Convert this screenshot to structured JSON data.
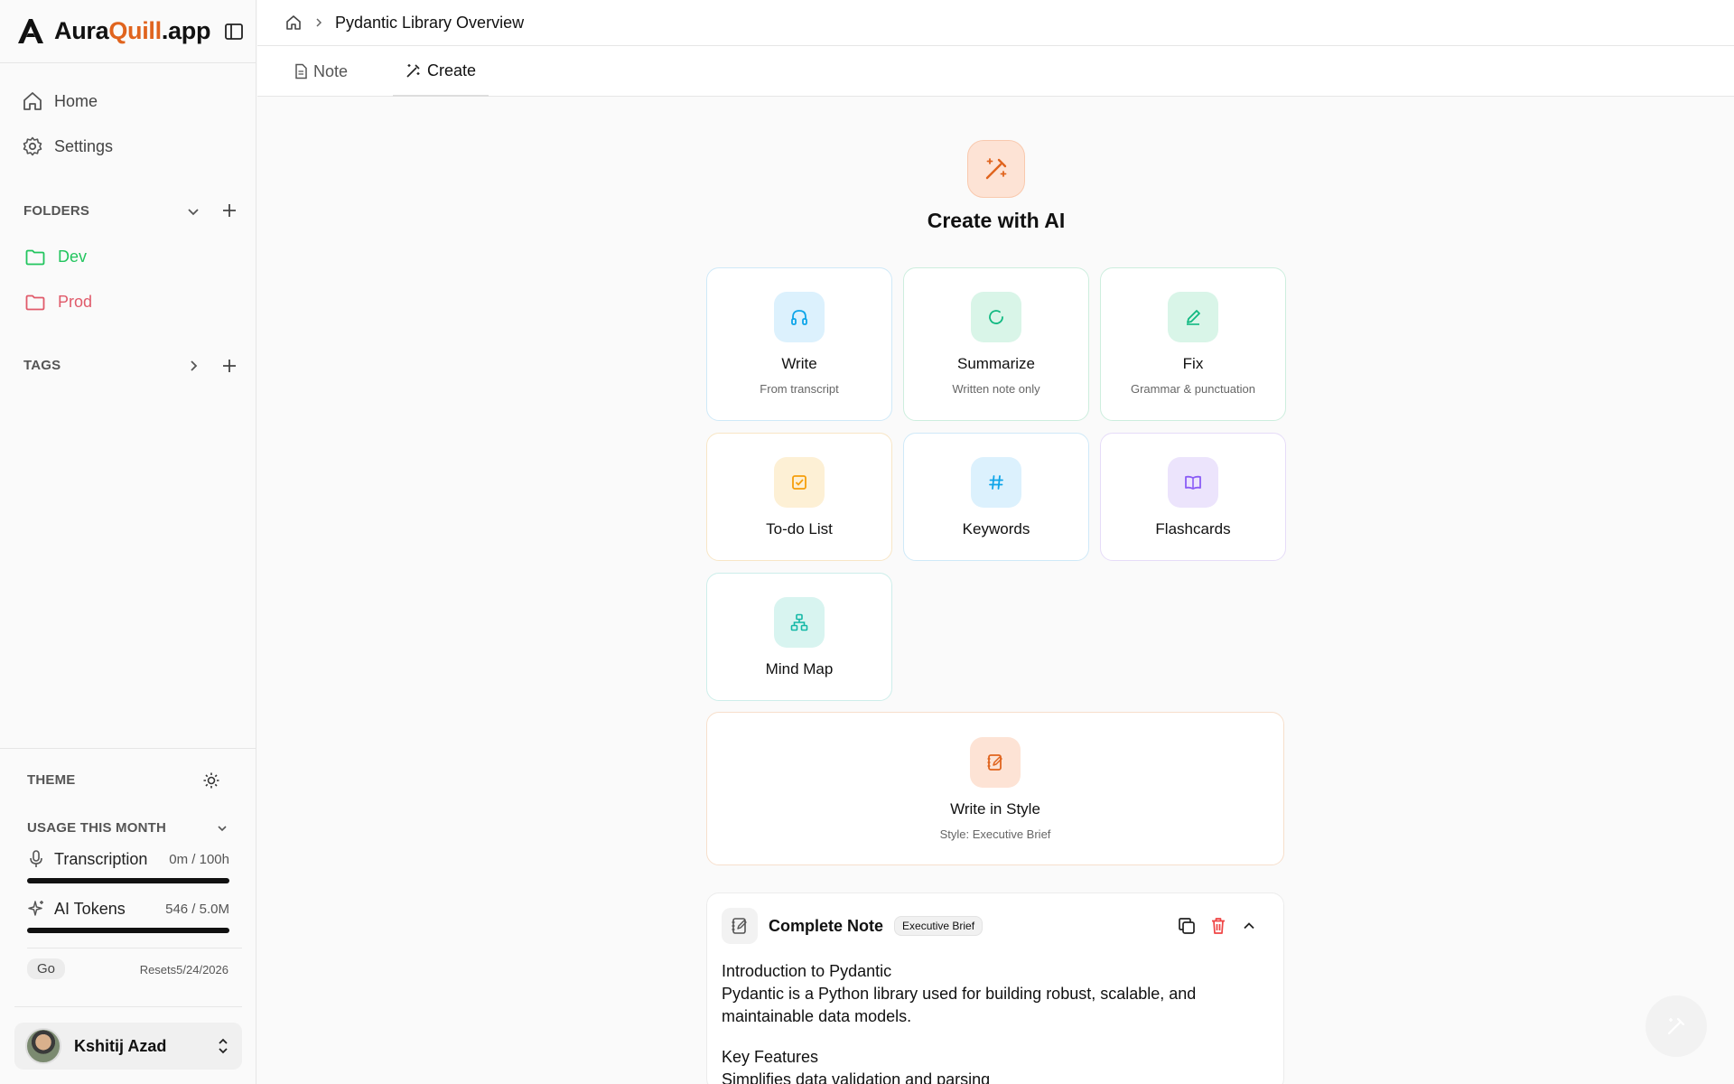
{
  "brand": {
    "name_part1": "Aura",
    "name_part2": "Quill",
    "name_part3": ".app",
    "accent": "#e0641e"
  },
  "sidebar": {
    "nav": [
      {
        "label": "Home",
        "icon": "home-icon"
      },
      {
        "label": "Settings",
        "icon": "gear-icon"
      }
    ],
    "folders_heading": "FOLDERS",
    "folders": [
      {
        "label": "Dev",
        "color": "#22c55e"
      },
      {
        "label": "Prod",
        "color": "#e05a6a"
      }
    ],
    "tags_heading": "TAGS",
    "theme_label": "THEME",
    "usage_heading": "USAGE THIS MONTH",
    "usage": [
      {
        "label": "Transcription",
        "amount": "0m / 100h",
        "icon": "microphone-icon"
      },
      {
        "label": "AI Tokens",
        "amount": "546 / 5.0M",
        "icon": "sparkle-icon"
      }
    ],
    "plan_label": "Go",
    "resets_label": "Resets",
    "resets_date": "5/24/2026",
    "user_name": "Kshitij Azad"
  },
  "breadcrumb": {
    "title": "Pydantic Library Overview"
  },
  "tabs": [
    {
      "label": "Note",
      "icon": "document-icon"
    },
    {
      "label": "Create",
      "icon": "magic-wand-icon"
    }
  ],
  "create": {
    "title": "Create with AI",
    "cards": [
      {
        "title": "Write",
        "subtitle": "From transcript",
        "icon": "headphones-icon",
        "color": "#0ea5e9"
      },
      {
        "title": "Summarize",
        "subtitle": "Written note only",
        "icon": "refresh-icon",
        "color": "#10b981"
      },
      {
        "title": "Fix",
        "subtitle": "Grammar & punctuation",
        "icon": "pencil-icon",
        "color": "#10b981"
      },
      {
        "title": "To-do List",
        "subtitle": "",
        "icon": "checkbox-icon",
        "color": "#f59e0b"
      },
      {
        "title": "Keywords",
        "subtitle": "",
        "icon": "hashtag-icon",
        "color": "#0ea5e9"
      },
      {
        "title": "Flashcards",
        "subtitle": "",
        "icon": "book-icon",
        "color": "#8b5cf6"
      },
      {
        "title": "Mind Map",
        "subtitle": "",
        "icon": "network-icon",
        "color": "#14b8a6"
      }
    ],
    "style_card": {
      "title": "Write in Style",
      "subtitle": "Style: Executive Brief"
    }
  },
  "note": {
    "title": "Complete Note",
    "badge": "Executive Brief",
    "heading1": "Introduction to Pydantic",
    "text1": "Pydantic is a Python library used for building robust, scalable, and maintainable data models.",
    "heading2": "Key Features",
    "text2": "Simplifies data validation and parsing"
  }
}
